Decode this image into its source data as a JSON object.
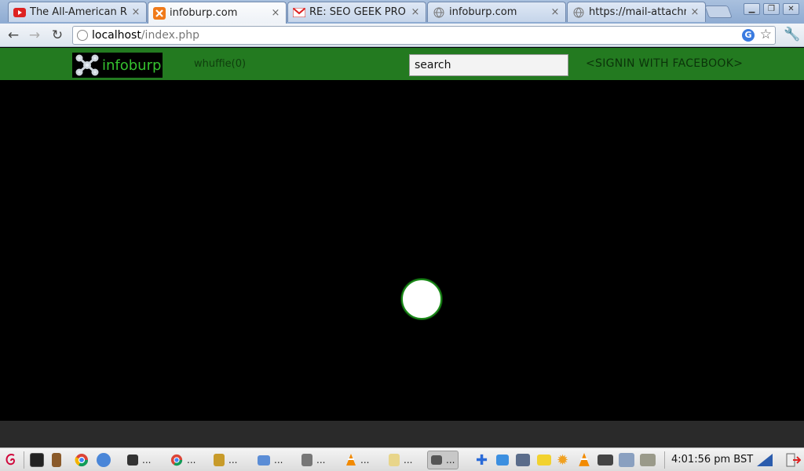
{
  "browser": {
    "tabs": [
      {
        "title": "The All-American Reje",
        "favicon": "youtube-icon"
      },
      {
        "title": "infoburp.com",
        "favicon": "xampp-icon",
        "active": true
      },
      {
        "title": "RE: SEO GEEK PROPO",
        "favicon": "gmail-icon"
      },
      {
        "title": "infoburp.com",
        "favicon": "globe-icon"
      },
      {
        "title": "https://mail-attachme",
        "favicon": "globe-icon"
      }
    ],
    "tab_close_glyph": "×",
    "url_host": "localhost",
    "url_path": "/index.php",
    "omnibox_icon_letter": "G"
  },
  "site": {
    "logo_text": "infoburp",
    "whuffie": "whuffie(0)",
    "search_value": "search",
    "signin": "<SIGNIN WITH FACEBOOK>"
  },
  "taskbar": {
    "dots": "...",
    "clock": "4:01:56 pm BST"
  },
  "colors": {
    "header_green": "#237a20",
    "logo_text_green": "#35c22f",
    "page_background": "#000000"
  }
}
